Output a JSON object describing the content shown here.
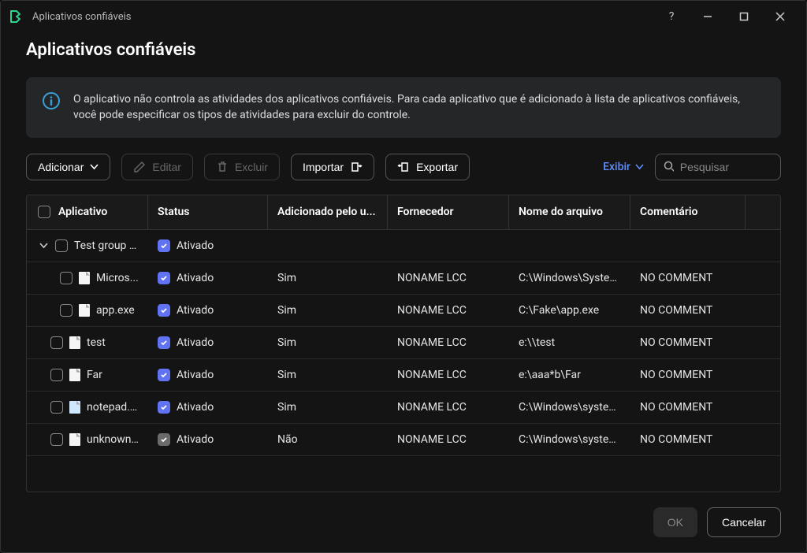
{
  "titlebar": {
    "title": "Aplicativos confiáveis"
  },
  "page": {
    "heading": "Aplicativos confiáveis"
  },
  "banner": {
    "text": "O aplicativo não controla as atividades dos aplicativos confiáveis. Para cada aplicativo que é adicionado à lista de aplicativos confiáveis, você pode especificar os tipos de atividades para excluir do controle."
  },
  "toolbar": {
    "add": "Adicionar",
    "edit": "Editar",
    "delete": "Excluir",
    "import": "Importar",
    "export": "Exportar",
    "view": "Exibir",
    "search_placeholder": "Pesquisar"
  },
  "columns": {
    "app": "Aplicativo",
    "status": "Status",
    "added": "Adicionado pelo u...",
    "vendor": "Fornecedor",
    "file": "Nome do arquivo",
    "comment": "Comentário"
  },
  "rows": [
    {
      "type": "group",
      "app": "Test group App",
      "status": "Ativado",
      "status_checked": true
    },
    {
      "type": "child",
      "app": "Micros...",
      "status": "Ativado",
      "status_checked": true,
      "added": "Sim",
      "vendor": "NONAME LCC",
      "file": "C:\\Windows\\System...",
      "comment": "NO COMMENT"
    },
    {
      "type": "child",
      "app": "app.exe",
      "status": "Ativado",
      "status_checked": true,
      "added": "Sim",
      "vendor": "NONAME LCC",
      "file": "C:\\Fake\\app.exe",
      "comment": "NO COMMENT"
    },
    {
      "type": "top",
      "app": "test",
      "status": "Ativado",
      "status_checked": true,
      "added": "Sim",
      "vendor": "NONAME LCC",
      "file": "e:\\\\test",
      "comment": "NO COMMENT"
    },
    {
      "type": "top",
      "app": "Far",
      "status": "Ativado",
      "status_checked": true,
      "added": "Sim",
      "vendor": "NONAME LCC",
      "file": "e:\\aaa*b\\Far",
      "comment": "NO COMMENT"
    },
    {
      "type": "top",
      "icon": "notepad",
      "app": "notepad.e...",
      "status": "Ativado",
      "status_checked": true,
      "added": "Sim",
      "vendor": "NONAME LCC",
      "file": "C:\\Windows\\system...",
      "comment": "NO COMMENT"
    },
    {
      "type": "top",
      "app": "unknown....",
      "status": "Ativado",
      "status_checked": true,
      "status_grey": true,
      "added": "Não",
      "vendor": "NONAME LCC",
      "file": "C:\\Windows\\system...",
      "comment": "NO COMMENT"
    }
  ],
  "footer": {
    "ok": "OK",
    "cancel": "Cancelar"
  }
}
